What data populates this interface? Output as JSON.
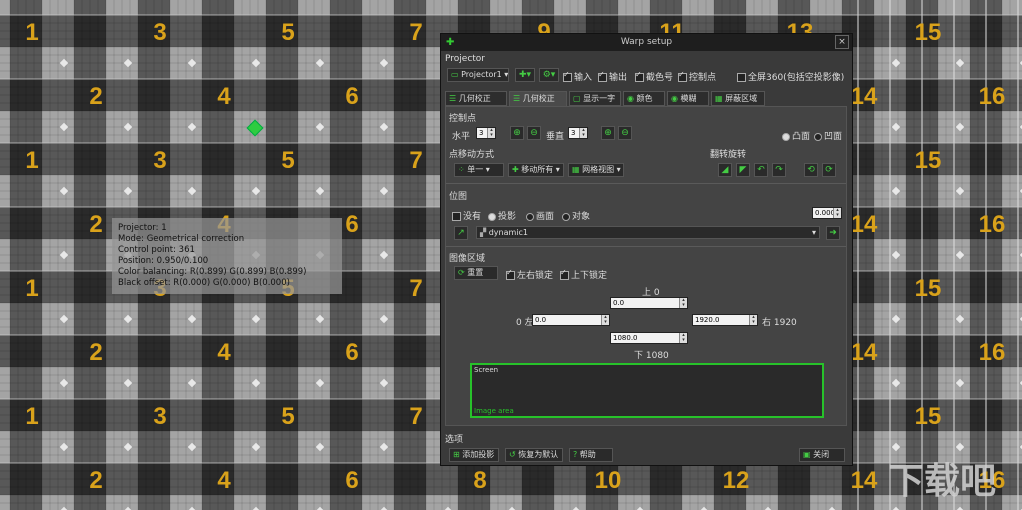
{
  "background": {
    "numbers_row_odd": [
      "1",
      "3",
      "5",
      "7",
      "9",
      "11",
      "13",
      "15"
    ],
    "numbers_row_even": [
      "2",
      "4",
      "6",
      "8",
      "10",
      "12",
      "14",
      "16"
    ],
    "number_color": "#d9a21b",
    "handle_color": "#2ecc40"
  },
  "info_overlay": {
    "lines": [
      "Projector: 1",
      "Mode: Geometrical correction",
      "Control point: 361",
      "Position: 0.950/0.100",
      "Color balancing: R(0.899) G(0.899) B(0.899)",
      "Black offset: R(0.000) G(0.000) B(0.000)"
    ]
  },
  "window": {
    "title": "Warp setup",
    "close": "×",
    "projector_section": "Projector",
    "projector_select": "Projector1",
    "cb1": "输入",
    "cb2": "输出",
    "cb3": "截色号",
    "cb4": "控制点",
    "all_label": "全屏360(包括空投影像)",
    "tabs": [
      "几何校正",
      "几何校正",
      "显示一字",
      "颜色",
      "模糊",
      "屏蔽区域"
    ],
    "control_points_label": "控制点",
    "count1": "3",
    "count2": "3",
    "count_label1": "水平",
    "count_label2": "垂直",
    "radio_in": "凸面",
    "radio_out": "凹面",
    "interp_label": "点移动方式",
    "interp1": "单一",
    "interp2": "移动所有",
    "interp3": "网格视图",
    "mirror_label": "翻转旋转",
    "warp_label": "位图",
    "none_label": "没有",
    "radio_a": "投影",
    "radio_b": "画面",
    "radio_c": "对象",
    "warp_val": "0.000",
    "dynamic_select": "dynamic1",
    "region_label": "图像区域",
    "reset_button": "重置",
    "lock_lr": "左右锁定",
    "lock_ud": "上下锁定",
    "top_label": "上 0",
    "top_val": "0.0",
    "left_label": "0 左",
    "left_val": "0.0",
    "right_val": "1920.0",
    "right_label": "右 1920",
    "bottom_val": "1080.0",
    "bottom_label": "下 1080",
    "screen_label": "Screen",
    "image_label": "Image area",
    "footer_label": "选项",
    "add_button": "添加投影",
    "restore_button": "恢复为默认",
    "help_button": "帮助",
    "close_button": "关闭"
  },
  "watermark": "下载吧"
}
